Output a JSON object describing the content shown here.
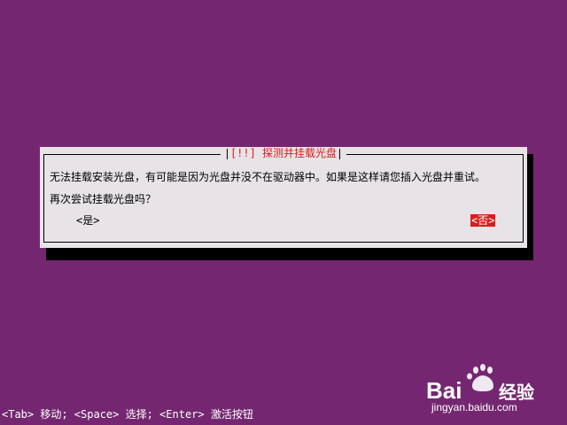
{
  "dialog": {
    "title": "[!!] 探测并挂载光盘",
    "message": "无法挂载安装光盘，有可能是因为光盘并没不在驱动器中。如果是这样请您插入光盘并重试。",
    "question": "再次尝试挂载光盘吗？",
    "yes_label": "<是>",
    "no_label": "<否>"
  },
  "status_bar": {
    "text": "<Tab> 移动; <Space> 选择; <Enter> 激活按钮"
  },
  "watermark": {
    "brand": "Bai",
    "brand_suffix": "经验",
    "url": "jingyan.baidu.com"
  },
  "colors": {
    "background": "#742770",
    "dialog": "#e7e3e7",
    "accent": "#d81e1e",
    "shadow": "#000000"
  }
}
